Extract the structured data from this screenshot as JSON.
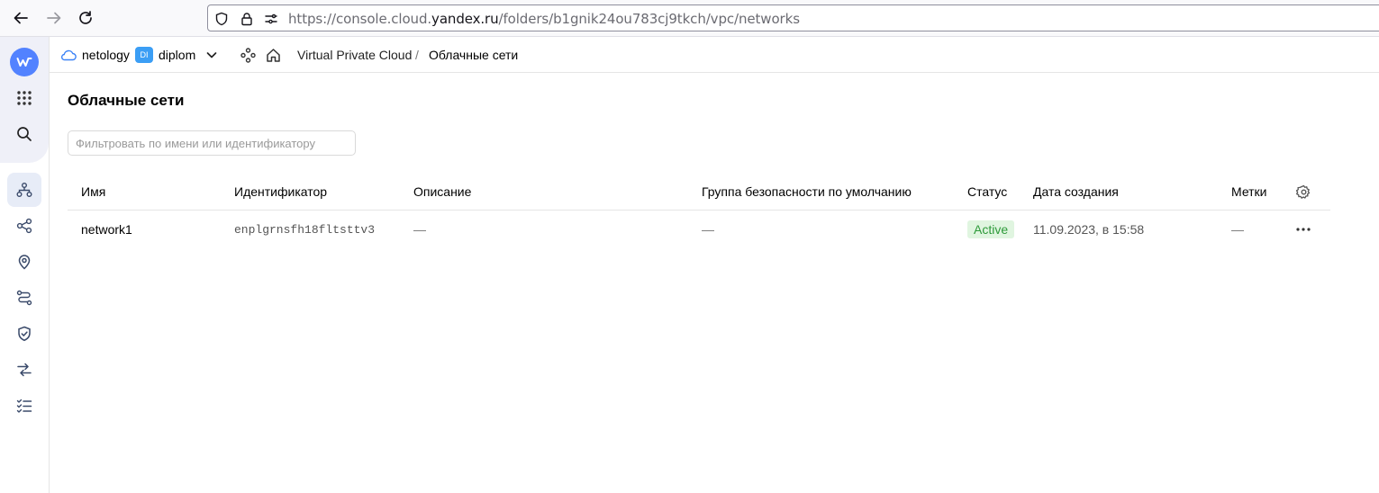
{
  "browser": {
    "url_prefix": "https://console.cloud.",
    "url_domain": "yandex.ru",
    "url_path": "/folders/b1gnik24ou783cj9tkch/vpc/networks"
  },
  "rail": {
    "items": [
      "vpc-networks-icon",
      "share-icon",
      "location-pin-icon",
      "routes-icon",
      "shield-icon",
      "transfer-icon",
      "checklist-icon"
    ]
  },
  "header": {
    "cloud_name": "netology",
    "folder_badge": "DI",
    "folder_name": "diplom",
    "breadcrumb_service": "Virtual Private Cloud",
    "breadcrumb_separator": "/",
    "breadcrumb_current": "Облачные сети"
  },
  "main": {
    "title": "Облачные сети",
    "filter_placeholder": "Фильтровать по имени или идентификатору",
    "columns": [
      "Имя",
      "Идентификатор",
      "Описание",
      "Группа безопасности по умолчанию",
      "Статус",
      "Дата создания",
      "Метки"
    ],
    "rows": [
      {
        "name": "network1",
        "id": "enplgrnsfh18fltsttv3",
        "description": "—",
        "security_group": "—",
        "status": "Active",
        "created": "11.09.2023, в 15:58",
        "labels": "—"
      }
    ]
  },
  "colors": {
    "accent": "#5282ff",
    "status_active_bg": "#e0f5e0",
    "status_active_text": "#2e9a3a"
  }
}
